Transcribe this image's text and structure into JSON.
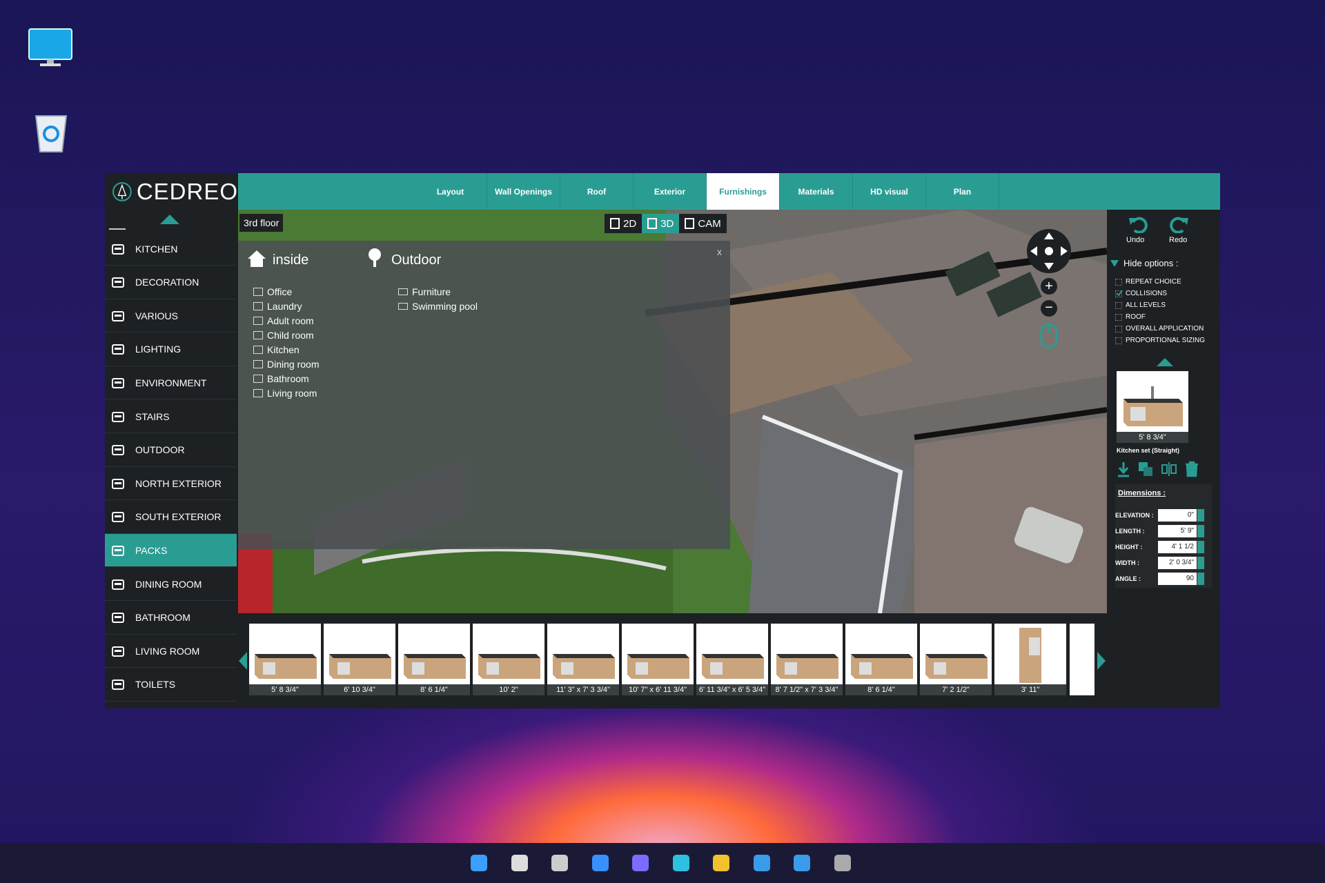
{
  "desktop": {
    "icons": [
      "monitor-icon",
      "recycle-bin-icon"
    ]
  },
  "app": {
    "brand": "CEDREO",
    "accent": "#2a9d93",
    "tabs": [
      {
        "label": "Layout",
        "active": false
      },
      {
        "label": "Wall Openings",
        "active": false
      },
      {
        "label": "Roof",
        "active": false
      },
      {
        "label": "Exterior",
        "active": false
      },
      {
        "label": "Furnishings",
        "active": true
      },
      {
        "label": "Materials",
        "active": false
      },
      {
        "label": "HD visual",
        "active": false
      },
      {
        "label": "Plan",
        "active": false
      }
    ],
    "sidebar": [
      {
        "label": "KITCHEN",
        "icon": "kitchen-icon"
      },
      {
        "label": "DECORATION",
        "icon": "decoration-icon"
      },
      {
        "label": "VARIOUS",
        "icon": "various-icon"
      },
      {
        "label": "LIGHTING",
        "icon": "lightbulb-icon"
      },
      {
        "label": "ENVIRONMENT",
        "icon": "environment-icon"
      },
      {
        "label": "STAIRS",
        "icon": "stairs-icon"
      },
      {
        "label": "OUTDOOR",
        "icon": "tree-icon"
      },
      {
        "label": "NORTH EXTERIOR",
        "icon": "tree-icon"
      },
      {
        "label": "SOUTH EXTERIOR",
        "icon": "tree-icon"
      },
      {
        "label": "PACKS",
        "icon": "packs-icon",
        "active": true
      },
      {
        "label": "DINING ROOM",
        "icon": "dining-icon"
      },
      {
        "label": "BATHROOM",
        "icon": "bathtub-icon"
      },
      {
        "label": "LIVING ROOM",
        "icon": "living-room-icon"
      },
      {
        "label": "TOILETS",
        "icon": "toilet-icon"
      }
    ],
    "viewport": {
      "floor": "3rd floor",
      "modes": [
        {
          "label": "2D",
          "active": false
        },
        {
          "label": "3D",
          "active": true
        },
        {
          "label": "CAM",
          "active": false
        }
      ],
      "popup": {
        "inside_title": "inside",
        "outdoor_title": "Outdoor",
        "close": "x",
        "inside_items": [
          "Office",
          "Laundry",
          "Adult room",
          "Child room",
          "Kitchen",
          "Dining room",
          "Bathroom",
          "Living room"
        ],
        "outdoor_items": [
          "Furniture",
          "Swimming pool"
        ]
      }
    },
    "right_panel": {
      "undo": "Undo",
      "redo": "Redo",
      "hide_options": "Hide options :",
      "options": [
        {
          "label": "REPEAT CHOICE",
          "checked": false
        },
        {
          "label": "COLLISIONS",
          "checked": true
        },
        {
          "label": "ALL LEVELS",
          "checked": false
        },
        {
          "label": "ROOF",
          "checked": false
        },
        {
          "label": "OVERALL APPLICATION",
          "checked": false
        },
        {
          "label": "PROPORTIONAL SIZING",
          "checked": false
        }
      ],
      "selected": {
        "size": "5' 8 3/4\"",
        "name": "Kitchen set (Straight)"
      },
      "dimensions_title": "Dimensions :",
      "dimensions": [
        {
          "label": "ELEVATION :",
          "value": "0\""
        },
        {
          "label": "LENGTH :",
          "value": "5' 9\""
        },
        {
          "label": "HEIGHT :",
          "value": "4' 1 1/2"
        },
        {
          "label": "WIDTH :",
          "value": "2' 0 3/4\""
        },
        {
          "label": "ANGLE :",
          "value": "90"
        }
      ]
    },
    "catalog": [
      "5' 8 3/4\"",
      "6' 10 3/4\"",
      "8' 6 1/4\"",
      "10' 2\"",
      "11' 3\" x 7' 3 3/4\"",
      "10' 7\" x 6' 11 3/4\"",
      "6' 11 3/4\" x 6' 5 3/4\"",
      "8' 7 1/2\" x 7' 3 3/4\"",
      "8' 6 1/4\"",
      "7' 2 1/2\"",
      "3' 11\""
    ]
  },
  "taskbar": {
    "icons": [
      "windows-start-icon",
      "search-icon",
      "task-view-icon",
      "widgets-icon",
      "chat-icon",
      "edge-icon",
      "file-explorer-icon",
      "store-icon",
      "mail-icon",
      "settings-icon"
    ]
  }
}
